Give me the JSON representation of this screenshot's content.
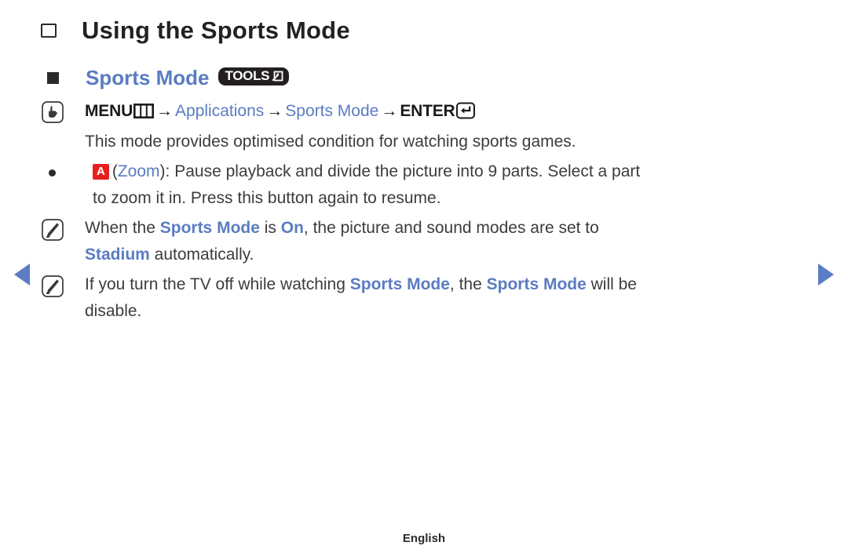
{
  "page": {
    "heading": "Using the Sports Mode",
    "footer_language": "English"
  },
  "nav": {
    "prev_label": "Previous page",
    "next_label": "Next page"
  },
  "section": {
    "title": "Sports Mode",
    "tools_badge_label": "TOOLS",
    "menu_path": {
      "menu_label": "MENU",
      "arrow1": "→",
      "item1": "Applications",
      "arrow2": "→",
      "item2": "Sports Mode",
      "arrow3": "→",
      "enter_label": "ENTER"
    },
    "description": "This mode provides optimised condition for watching sports games.",
    "bullets": [
      {
        "badge": "A",
        "lead_paren_open": "(",
        "lead_link": "Zoom",
        "lead_paren_close": "):",
        "text_line1": "Pause playback and divide the picture into 9 parts. Select a part",
        "text_line2": "to zoom it in. Press this button again to resume."
      }
    ],
    "notes": [
      {
        "part1": "When the ",
        "hl1": "Sports Mode",
        "part2": " is ",
        "hl2": "On",
        "part3": ", the picture and sound modes are set to",
        "hl3": "Stadium",
        "part4": " automatically."
      },
      {
        "part1": "If you turn the TV off while watching ",
        "hl1": "Sports Mode",
        "part2": ", the ",
        "hl2": "Sports Mode",
        "part3": " will be",
        "part4": "disable."
      }
    ]
  },
  "colors": {
    "accent_blue": "#5b7cc2",
    "badge_red": "#e8201d",
    "badge_dark": "#231f20",
    "text": "#3c3c3c"
  }
}
